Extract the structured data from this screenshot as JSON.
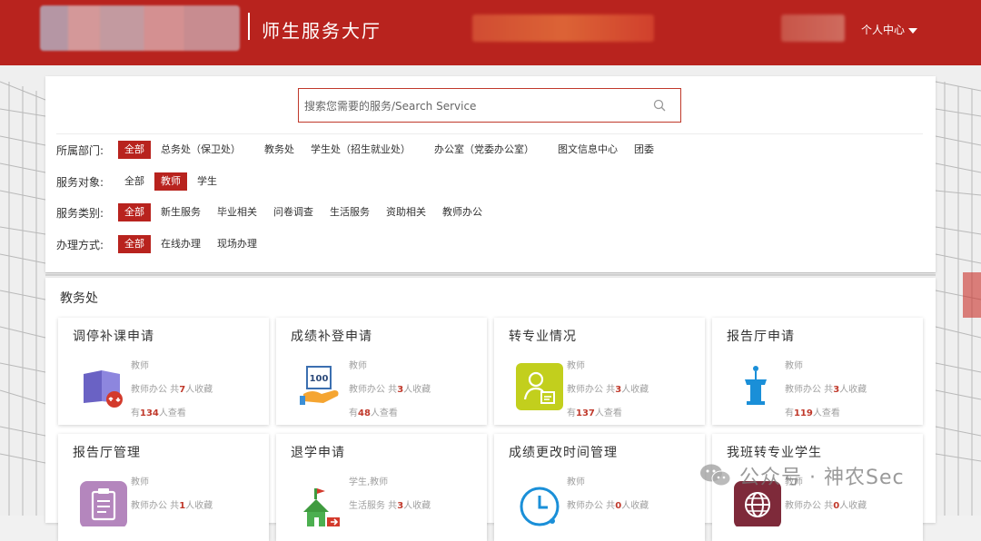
{
  "header": {
    "title": "师生服务大厅",
    "user_center": "个人中心"
  },
  "search": {
    "placeholder": "搜索您需要的服务/Search Service"
  },
  "filters": [
    {
      "label": "所属部门:",
      "options": [
        "全部",
        "总务处（保卫处）",
        "教务处",
        "学生处（招生就业处）",
        "办公室（党委办公室）",
        "图文信息中心",
        "团委"
      ],
      "active": 0
    },
    {
      "label": "服务对象:",
      "options": [
        "全部",
        "教师",
        "学生"
      ],
      "active": 1
    },
    {
      "label": "服务类别:",
      "options": [
        "全部",
        "新生服务",
        "毕业相关",
        "问卷调查",
        "生活服务",
        "资助相关",
        "教师办公"
      ],
      "active": 0
    },
    {
      "label": "办理方式:",
      "options": [
        "全部",
        "在线办理",
        "现场办理"
      ],
      "active": 0
    }
  ],
  "section": {
    "title": "教务处",
    "cards": [
      {
        "title": "调停补课申请",
        "audience": "教师",
        "category": "教师办公",
        "fav_prefix": " 共",
        "fav_count": "7",
        "fav_suffix": "人收藏",
        "view_prefix": "有",
        "view_count": "134",
        "view_suffix": "人查看",
        "icon": "book-swap-icon"
      },
      {
        "title": "成绩补登申请",
        "audience": "教师",
        "category": "教师办公",
        "fav_prefix": " 共",
        "fav_count": "3",
        "fav_suffix": "人收藏",
        "view_prefix": "有",
        "view_count": "48",
        "view_suffix": "人查看",
        "icon": "score-100-icon"
      },
      {
        "title": "转专业情况",
        "audience": "教师",
        "category": "教师办公",
        "fav_prefix": " 共",
        "fav_count": "3",
        "fav_suffix": "人收藏",
        "view_prefix": "有",
        "view_count": "137",
        "view_suffix": "人查看",
        "icon": "user-card-icon"
      },
      {
        "title": "报告厅申请",
        "audience": "教师",
        "category": "教师办公",
        "fav_prefix": " 共",
        "fav_count": "3",
        "fav_suffix": "人收藏",
        "view_prefix": "有",
        "view_count": "119",
        "view_suffix": "人查看",
        "icon": "podium-icon"
      },
      {
        "title": "报告厅管理",
        "audience": "教师",
        "category": "教师办公",
        "fav_prefix": " 共",
        "fav_count": "1",
        "fav_suffix": "人收藏",
        "icon": "clipboard-icon"
      },
      {
        "title": "退学申请",
        "audience": "学生,教师",
        "category": "生活服务",
        "fav_prefix": " 共",
        "fav_count": "3",
        "fav_suffix": "人收藏",
        "icon": "school-exit-icon"
      },
      {
        "title": "成绩更改时间管理",
        "audience": "教师",
        "category": "教师办公",
        "fav_prefix": " 共",
        "fav_count": "0",
        "fav_suffix": "人收藏",
        "icon": "clock-icon"
      },
      {
        "title": "我班转专业学生",
        "audience": "教师",
        "category": "教师办公",
        "fav_prefix": " 共",
        "fav_count": "0",
        "fav_suffix": "人收藏",
        "icon": "globe-icon"
      }
    ]
  },
  "watermark": "公众号 · 神农Sec",
  "colors": {
    "brand": "#b8231e",
    "highlight": "#c0392b"
  }
}
